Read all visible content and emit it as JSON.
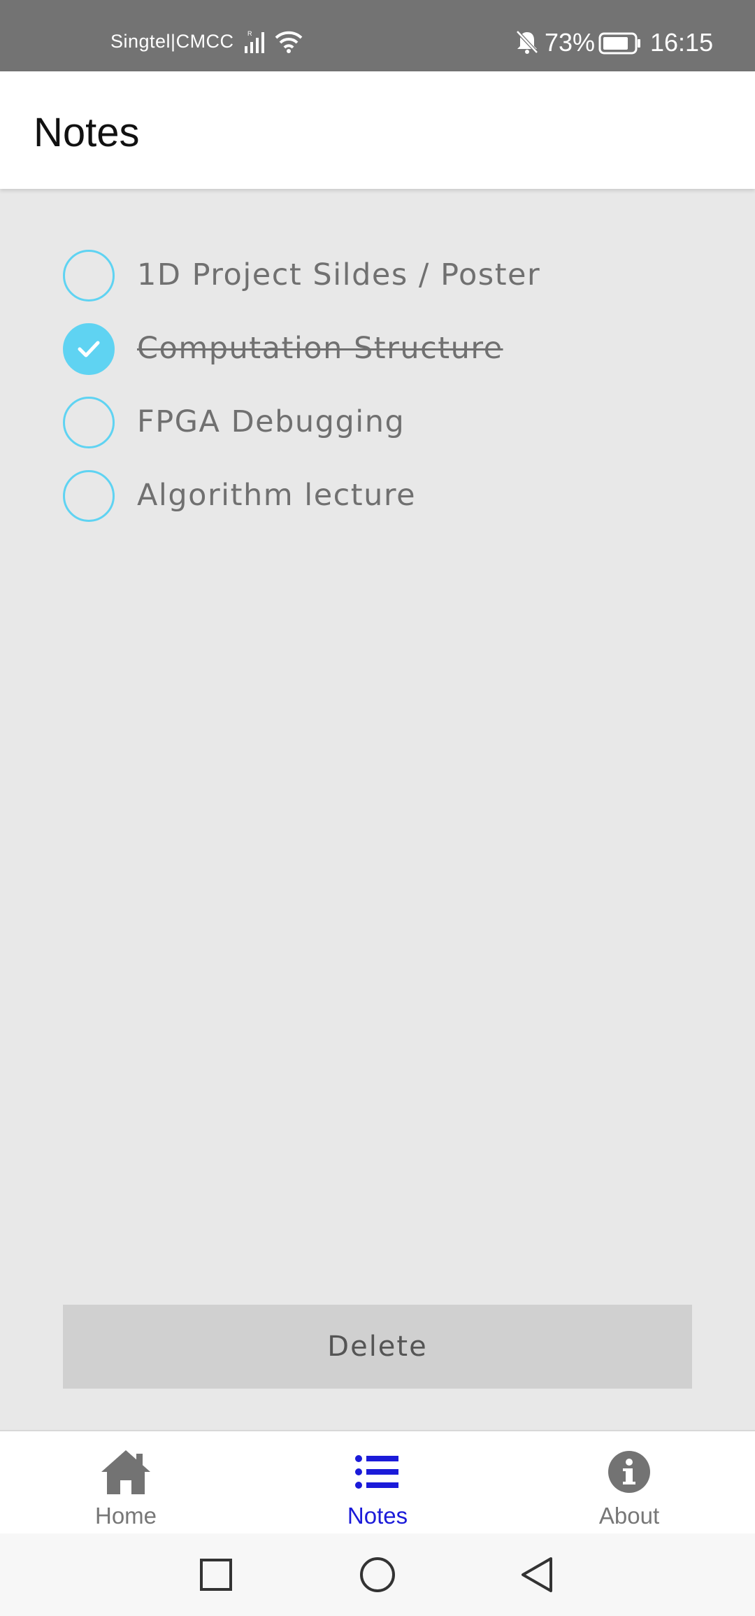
{
  "status_bar": {
    "carrier": "Singtel|CMCC",
    "battery_percent": "73%",
    "time": "16:15"
  },
  "app_bar": {
    "title": "Notes"
  },
  "tasks": [
    {
      "label": "1D Project Sildes / Poster",
      "checked": false
    },
    {
      "label": "Computation Structure",
      "checked": true
    },
    {
      "label": "FPGA Debugging",
      "checked": false
    },
    {
      "label": "Algorithm lecture",
      "checked": false
    }
  ],
  "delete_button": {
    "label": "Delete"
  },
  "bottom_nav": {
    "items": [
      {
        "label": "Home",
        "icon": "home-icon",
        "active": false
      },
      {
        "label": "Notes",
        "icon": "list-icon",
        "active": true
      },
      {
        "label": "About",
        "icon": "info-icon",
        "active": false
      }
    ]
  },
  "colors": {
    "accent": "#5fd3f2",
    "active_nav": "#1b1bd9",
    "status_bar": "#737373",
    "background": "#e8e8e8"
  }
}
